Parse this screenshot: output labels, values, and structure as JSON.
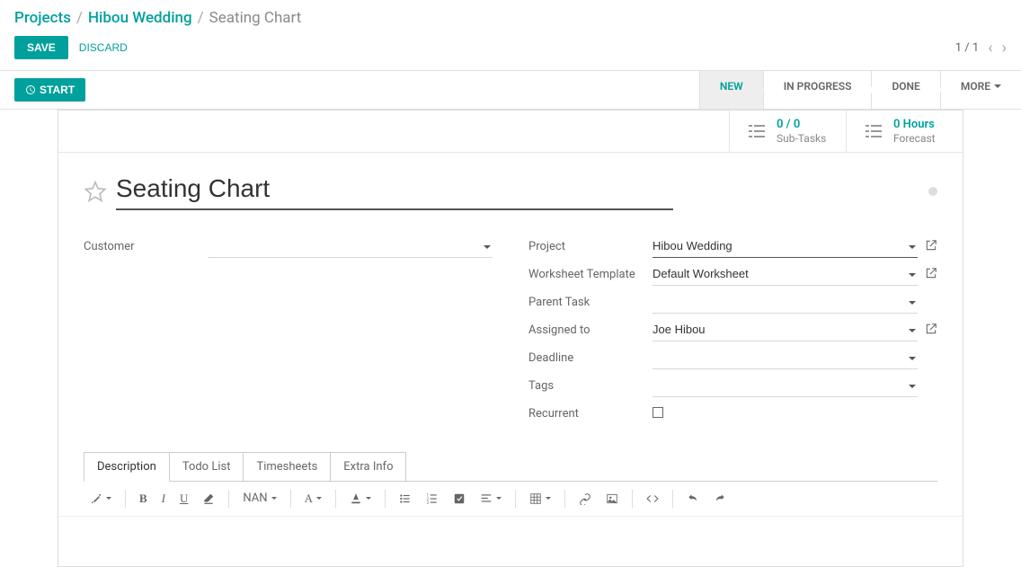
{
  "breadcrumb": {
    "root": "Projects",
    "project": "Hibou Wedding",
    "current": "Seating Chart"
  },
  "actions": {
    "save": "SAVE",
    "discard": "DISCARD",
    "start": "START"
  },
  "pager": {
    "text": "1 / 1"
  },
  "status": {
    "s1": "NEW",
    "s2": "IN PROGRESS",
    "s3": "DONE",
    "more": "MORE"
  },
  "stats": {
    "subtasks_num": "0 / 0",
    "subtasks_lbl": "Sub-Tasks",
    "forecast_num": "0  Hours",
    "forecast_lbl": "Forecast"
  },
  "title": "Seating Chart",
  "labels": {
    "customer": "Customer",
    "project": "Project",
    "template": "Worksheet Template",
    "parent": "Parent Task",
    "assigned": "Assigned to",
    "deadline": "Deadline",
    "tags": "Tags",
    "recurrent": "Recurrent"
  },
  "values": {
    "customer": "",
    "project": "Hibou Wedding",
    "template": "Default Worksheet",
    "parent": "",
    "assigned": "Joe Hibou",
    "deadline": "",
    "tags": ""
  },
  "tabs": {
    "t1": "Description",
    "t2": "Todo List",
    "t3": "Timesheets",
    "t4": "Extra Info"
  },
  "toolbar": {
    "font_size": "NAN",
    "font_family": "A"
  }
}
